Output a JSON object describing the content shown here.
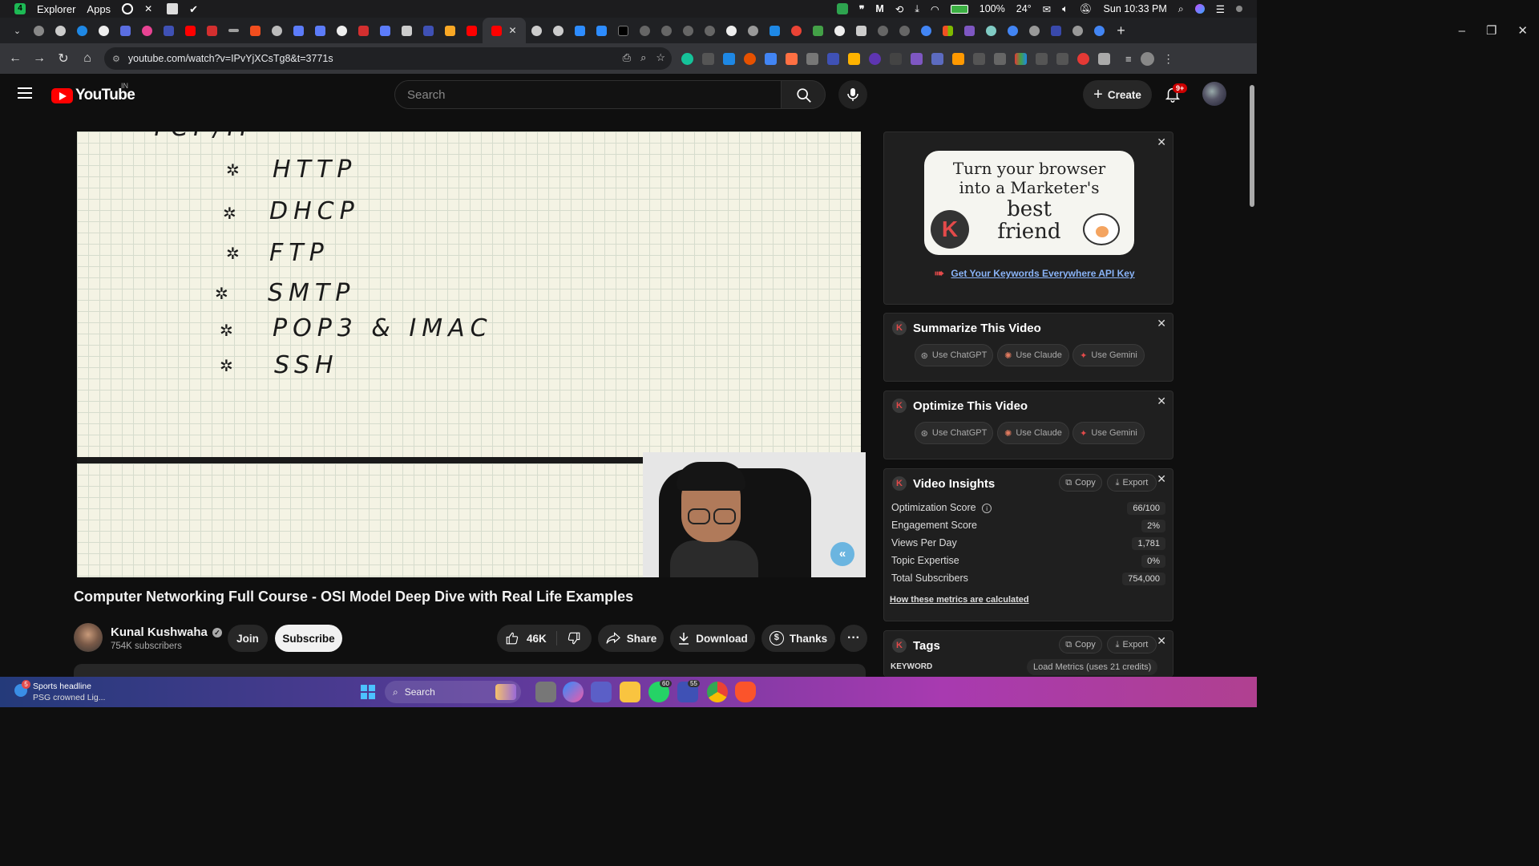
{
  "menubar": {
    "app_badge": "4",
    "items": [
      "Explorer",
      "Apps"
    ],
    "battery": "100%",
    "weather": "24°",
    "clock": "Sun 10:33 PM"
  },
  "address": {
    "url": "youtube.com/watch?v=IPvYjXCsTg8&t=3771s"
  },
  "yt": {
    "logo_text": "YouTube",
    "country": "IN",
    "search_placeholder": "Search",
    "create_label": "Create",
    "notif_badge": "9+"
  },
  "whiteboard": {
    "partial_line": "TCP/IP",
    "protocols": [
      "HTTP",
      "DHCP",
      "FTP",
      "SMTP",
      "POP3 & IMAC",
      "SSH"
    ]
  },
  "video": {
    "title": "Computer Networking Full Course - OSI Model Deep Dive with Real Life Examples",
    "channel": "Kunal Kushwaha",
    "subscribers": "754K subscribers",
    "join_label": "Join",
    "subscribe_label": "Subscribe",
    "likes": "46K",
    "share_label": "Share",
    "download_label": "Download",
    "thanks_label": "Thanks",
    "more_label": "···"
  },
  "ad": {
    "line1": "Turn your browser",
    "line2": "into a Marketer's",
    "line3": "best",
    "line4": "friend",
    "link": "Get Your Keywords Everywhere API Key"
  },
  "summarize": {
    "title": "Summarize This Video",
    "buttons": [
      "Use ChatGPT",
      "Use Claude",
      "Use Gemini"
    ]
  },
  "optimize": {
    "title": "Optimize This Video",
    "buttons": [
      "Use ChatGPT",
      "Use Claude",
      "Use Gemini"
    ]
  },
  "insights": {
    "title": "Video Insights",
    "copy": "Copy",
    "export": "Export",
    "metrics": [
      {
        "label": "Optimization Score",
        "value": "66/100"
      },
      {
        "label": "Engagement Score",
        "value": "2%"
      },
      {
        "label": "Views Per Day",
        "value": "1,781"
      },
      {
        "label": "Topic Expertise",
        "value": "0%"
      },
      {
        "label": "Total Subscribers",
        "value": "754,000"
      }
    ],
    "link": "How these metrics are calculated"
  },
  "tags": {
    "title": "Tags",
    "copy": "Copy",
    "export": "Export",
    "column": "KEYWORD",
    "load": "Load Metrics (uses 21 credits)"
  },
  "taskbar": {
    "news_badge": "5",
    "news_title": "Sports headline",
    "news_sub": "PSG crowned Lig...",
    "search": "Search",
    "badge_a": "60",
    "badge_b": "55"
  },
  "colors": {
    "yt_red": "#ff0000",
    "accent_link": "#8ab4f8",
    "k_red": "#e34a4a"
  }
}
